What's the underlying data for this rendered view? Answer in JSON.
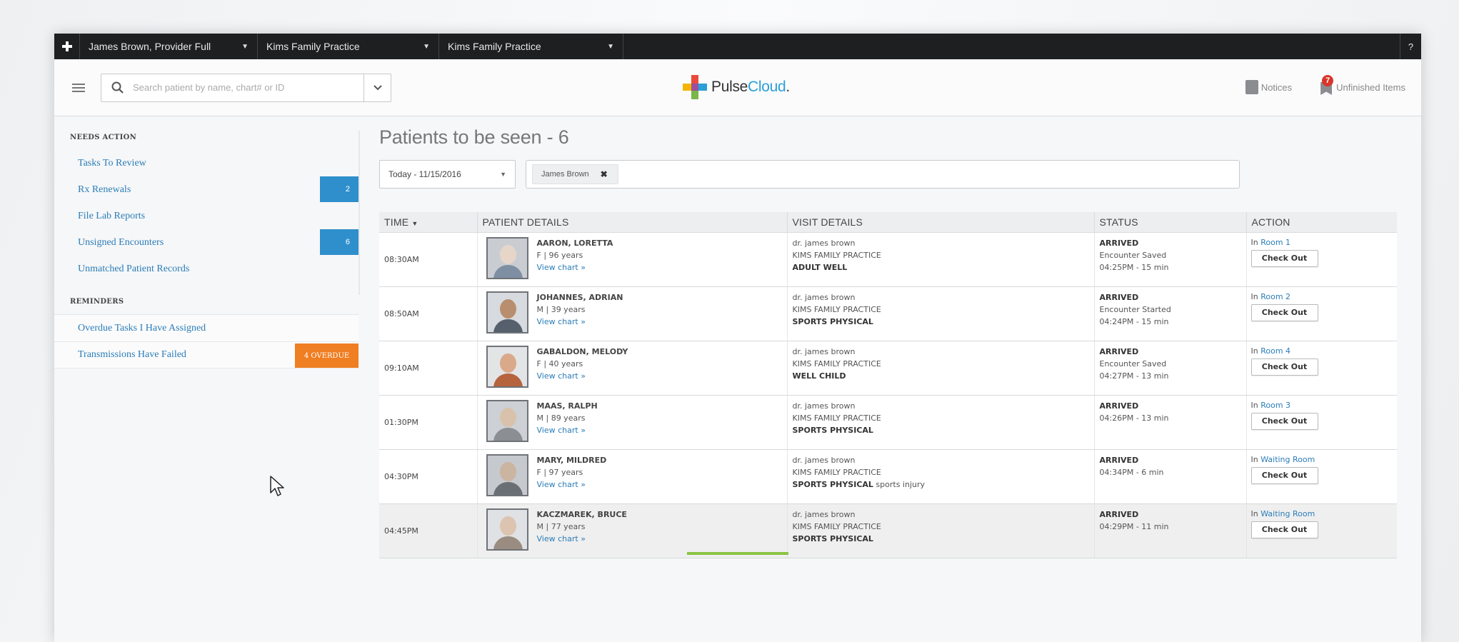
{
  "topbar": {
    "user": "James Brown, Provider Full",
    "practice1": "Kims Family Practice",
    "practice2": "Kims Family Practice",
    "help": "?"
  },
  "header": {
    "search_placeholder": "Search patient by name, chart# or ID",
    "logo_pulse": "Pulse",
    "logo_cloud": "Cloud",
    "logo_suffix": ".",
    "notices": "Notices",
    "unfinished": "Unfinished Items",
    "unfinished_count": "7"
  },
  "sidebar": {
    "needs_action_title": "NEEDS ACTION",
    "needs_action": [
      {
        "label": "Tasks To Review",
        "badge": ""
      },
      {
        "label": "Rx Renewals",
        "badge": "2"
      },
      {
        "label": "File Lab Reports",
        "badge": ""
      },
      {
        "label": "Unsigned Encounters",
        "badge": "6"
      },
      {
        "label": "Unmatched Patient Records",
        "badge": ""
      }
    ],
    "reminders_title": "REMINDERS",
    "reminders": [
      {
        "label": "Overdue Tasks I Have Assigned",
        "badge": ""
      },
      {
        "label": "Transmissions Have Failed",
        "badge": "4 OVERDUE"
      }
    ]
  },
  "main": {
    "title": "Patients to be seen - 6",
    "date_filter": "Today - 11/15/2016",
    "provider_chip": "James Brown",
    "columns": {
      "time": "TIME",
      "patient": "PATIENT DETAILS",
      "visit": "VISIT DETAILS",
      "status": "STATUS",
      "action": "ACTION"
    },
    "check_out_label": "Check Out",
    "rows": [
      {
        "time": "08:30AM",
        "name": "AARON, LORETTA",
        "demo": "F | 96 years",
        "chart": "View chart »",
        "provider": "dr. james brown",
        "practice": "KIMS FAMILY PRACTICE",
        "visit_type": "ADULT WELL",
        "visit_note": "",
        "status": "ARRIVED",
        "status_detail": "Encounter Saved",
        "status_time": "04:25PM - 15 min",
        "room_prefix": "In",
        "room": "Room 1"
      },
      {
        "time": "08:50AM",
        "name": "JOHANNES, ADRIAN",
        "demo": "M | 39 years",
        "chart": "View chart »",
        "provider": "dr. james brown",
        "practice": "KIMS FAMILY PRACTICE",
        "visit_type": "SPORTS PHYSICAL",
        "visit_note": "",
        "status": "ARRIVED",
        "status_detail": "Encounter Started",
        "status_time": "04:24PM - 15 min",
        "room_prefix": "In",
        "room": "Room 2"
      },
      {
        "time": "09:10AM",
        "name": "GABALDON, MELODY",
        "demo": "F | 40 years",
        "chart": "View chart »",
        "provider": "dr. james brown",
        "practice": "KIMS FAMILY PRACTICE",
        "visit_type": "WELL CHILD",
        "visit_note": "",
        "status": "ARRIVED",
        "status_detail": "Encounter Saved",
        "status_time": "04:27PM - 13 min",
        "room_prefix": "In",
        "room": "Room 4"
      },
      {
        "time": "01:30PM",
        "name": "MAAS, RALPH",
        "demo": "M | 89 years",
        "chart": "View chart »",
        "provider": "dr. james brown",
        "practice": "KIMS FAMILY PRACTICE",
        "visit_type": "SPORTS PHYSICAL",
        "visit_note": "",
        "status": "ARRIVED",
        "status_detail": "04:26PM - 13 min",
        "status_time": "",
        "room_prefix": "In",
        "room": "Room 3"
      },
      {
        "time": "04:30PM",
        "name": "MARY, MILDRED",
        "demo": "F | 97 years",
        "chart": "View chart »",
        "provider": "dr. james brown",
        "practice": "KIMS FAMILY PRACTICE",
        "visit_type": "SPORTS PHYSICAL",
        "visit_note": " sports injury",
        "status": "ARRIVED",
        "status_detail": "04:34PM - 6 min",
        "status_time": "",
        "room_prefix": "In",
        "room": "Waiting Room"
      },
      {
        "time": "04:45PM",
        "name": "KACZMAREK, BRUCE",
        "demo": "M | 77 years",
        "chart": "View chart »",
        "provider": "dr. james brown",
        "practice": "KIMS FAMILY PRACTICE",
        "visit_type": "SPORTS PHYSICAL",
        "visit_note": "",
        "status": "ARRIVED",
        "status_detail": "04:29PM - 11 min",
        "status_time": "",
        "room_prefix": "In",
        "room": "Waiting Room"
      }
    ]
  },
  "colors": {
    "accent_blue": "#2f8fcc",
    "overdue_orange": "#f07e22",
    "link_blue": "#2b7db8",
    "topbar_dark": "#1e1f21",
    "progress_green": "#8ac443"
  }
}
